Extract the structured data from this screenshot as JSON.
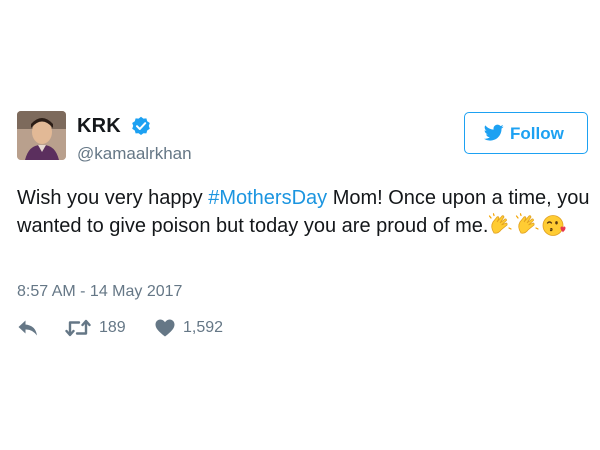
{
  "user": {
    "display_name": "KRK",
    "handle": "@kamaalrkhan",
    "verified": true,
    "avatar_icon": "profile-photo"
  },
  "follow_button": {
    "label": "Follow",
    "icon": "twitter-bird-icon",
    "color": "#1da1f2"
  },
  "tweet": {
    "text_before": "Wish you very happy ",
    "hashtag": "#MothersDay",
    "text_after": " Mom! Once upon a time, you wanted to give poison but today you are proud of me.",
    "emojis": [
      "clapping-hands-emoji",
      "clapping-hands-emoji",
      "face-blowing-kiss-emoji"
    ],
    "hashtag_color": "#1b95e0"
  },
  "timestamp": "8:57 AM - 14 May 2017",
  "actions": {
    "reply_icon": "reply-icon",
    "retweet_icon": "retweet-icon",
    "retweet_count": "189",
    "like_icon": "heart-icon",
    "like_count": "1,592"
  }
}
